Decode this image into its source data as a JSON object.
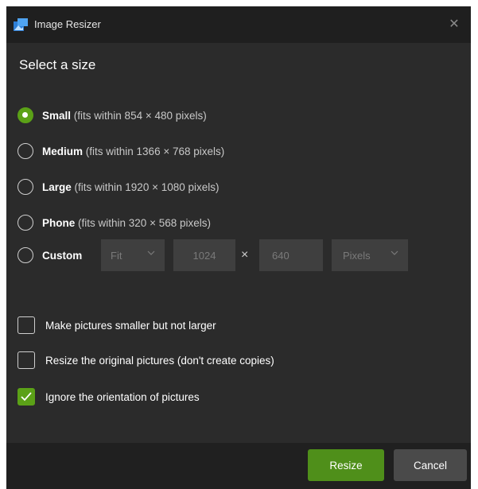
{
  "window": {
    "title": "Image Resizer",
    "close_glyph": "✕",
    "app_icon": "image-resizer-icon"
  },
  "heading": "Select a size",
  "sizes": [
    {
      "name": "Small",
      "desc": "(fits within 854 × 480 pixels)",
      "selected": true
    },
    {
      "name": "Medium",
      "desc": "(fits within 1366 × 768 pixels)",
      "selected": false
    },
    {
      "name": "Large",
      "desc": "(fits within 1920 × 1080 pixels)",
      "selected": false
    },
    {
      "name": "Phone",
      "desc": "(fits within 320 × 568 pixels)",
      "selected": false
    },
    {
      "name": "Custom",
      "selected": false
    }
  ],
  "custom": {
    "fit_value": "Fit",
    "width_value": "1024",
    "times": "×",
    "height_value": "640",
    "unit_value": "Pixels"
  },
  "options": [
    {
      "label": "Make pictures smaller but not larger",
      "checked": false
    },
    {
      "label": "Resize the original pictures (don't create copies)",
      "checked": false
    },
    {
      "label": "Ignore the orientation of pictures",
      "checked": true
    }
  ],
  "buttons": {
    "resize": "Resize",
    "cancel": "Cancel"
  },
  "colors": {
    "accent": "#5ba117",
    "background": "#2b2b2b",
    "titlebar": "#1f1f1f",
    "footer": "#202020"
  }
}
